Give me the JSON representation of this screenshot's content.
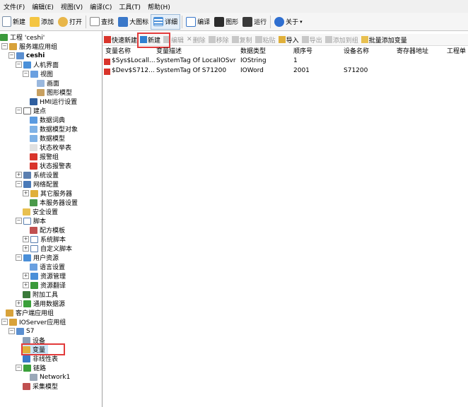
{
  "menubar": [
    "文件(F)",
    "编辑(E)",
    "视图(V)",
    "编译(C)",
    "工具(T)",
    "帮助(H)"
  ],
  "toolbar": {
    "new": "新建",
    "add": "添加",
    "open": "打开",
    "find": "查找",
    "large_icon": "大图标",
    "details": "详细",
    "compile": "编译",
    "graphics": "图形",
    "run": "运行",
    "about": "关于"
  },
  "tree": {
    "project": "工程 'ceshi'",
    "server_app_group": "服务端应用组",
    "ceshi": "ceshi",
    "hmi": "人机界面",
    "view": "视图",
    "screen": "画面",
    "graph_model": "图形模型",
    "hmi_settings": "HMI运行设置",
    "points": "建点",
    "data_dict": "数据词典",
    "data_model_obj": "数据模型对象",
    "data_model": "数据模型",
    "state_enum": "状态枚举表",
    "alarm_group": "报警组",
    "state_alarm": "状态报警表",
    "sys_settings": "系统设置",
    "network_config": "网络配置",
    "other_servers": "其它服务器",
    "local_server": "本服务器设置",
    "security": "安全设置",
    "scripts": "脚本",
    "recipe": "配方模板",
    "sys_script": "系统脚本",
    "custom_script": "自定义脚本",
    "user_res": "用户资源",
    "lang_settings": "语言设置",
    "res_mgmt": "资源管理",
    "res_translate": "资源翻译",
    "addon_tools": "附加工具",
    "common_ds": "通用数据源",
    "client_app_group": "客户端应用组",
    "ioserver_app_group": "IOServer应用组",
    "s7": "S7",
    "device": "设备",
    "variables": "变量",
    "nonlinear": "非线性表",
    "link": "链路",
    "network1": "Network1",
    "collect_model": "采集模型"
  },
  "subtoolbar": {
    "quick_new": "快速新建",
    "new": "新建",
    "edit": "编辑",
    "delete": "删除",
    "remove": "移除",
    "copy": "复制",
    "paste": "粘贴",
    "import": "导入",
    "export": "导出",
    "add_to_group": "添加到组",
    "batch_add": "批量添加变量"
  },
  "grid": {
    "columns": [
      "变量名称",
      "变量描述",
      "数据类型",
      "顺序号",
      "设备名称",
      "寄存器地址",
      "工程单"
    ],
    "rows": [
      [
        "$Sys$Locall...",
        "SystemTag Of LocalIOSvr",
        "IOString",
        "1",
        "",
        "",
        ""
      ],
      [
        "$Dev$S712...",
        "SystemTag Of S71200",
        "IOWord",
        "2001",
        "S71200",
        "",
        ""
      ]
    ]
  },
  "colors": {
    "highlight": "#e23b3b",
    "selection": "#cce4f7"
  }
}
